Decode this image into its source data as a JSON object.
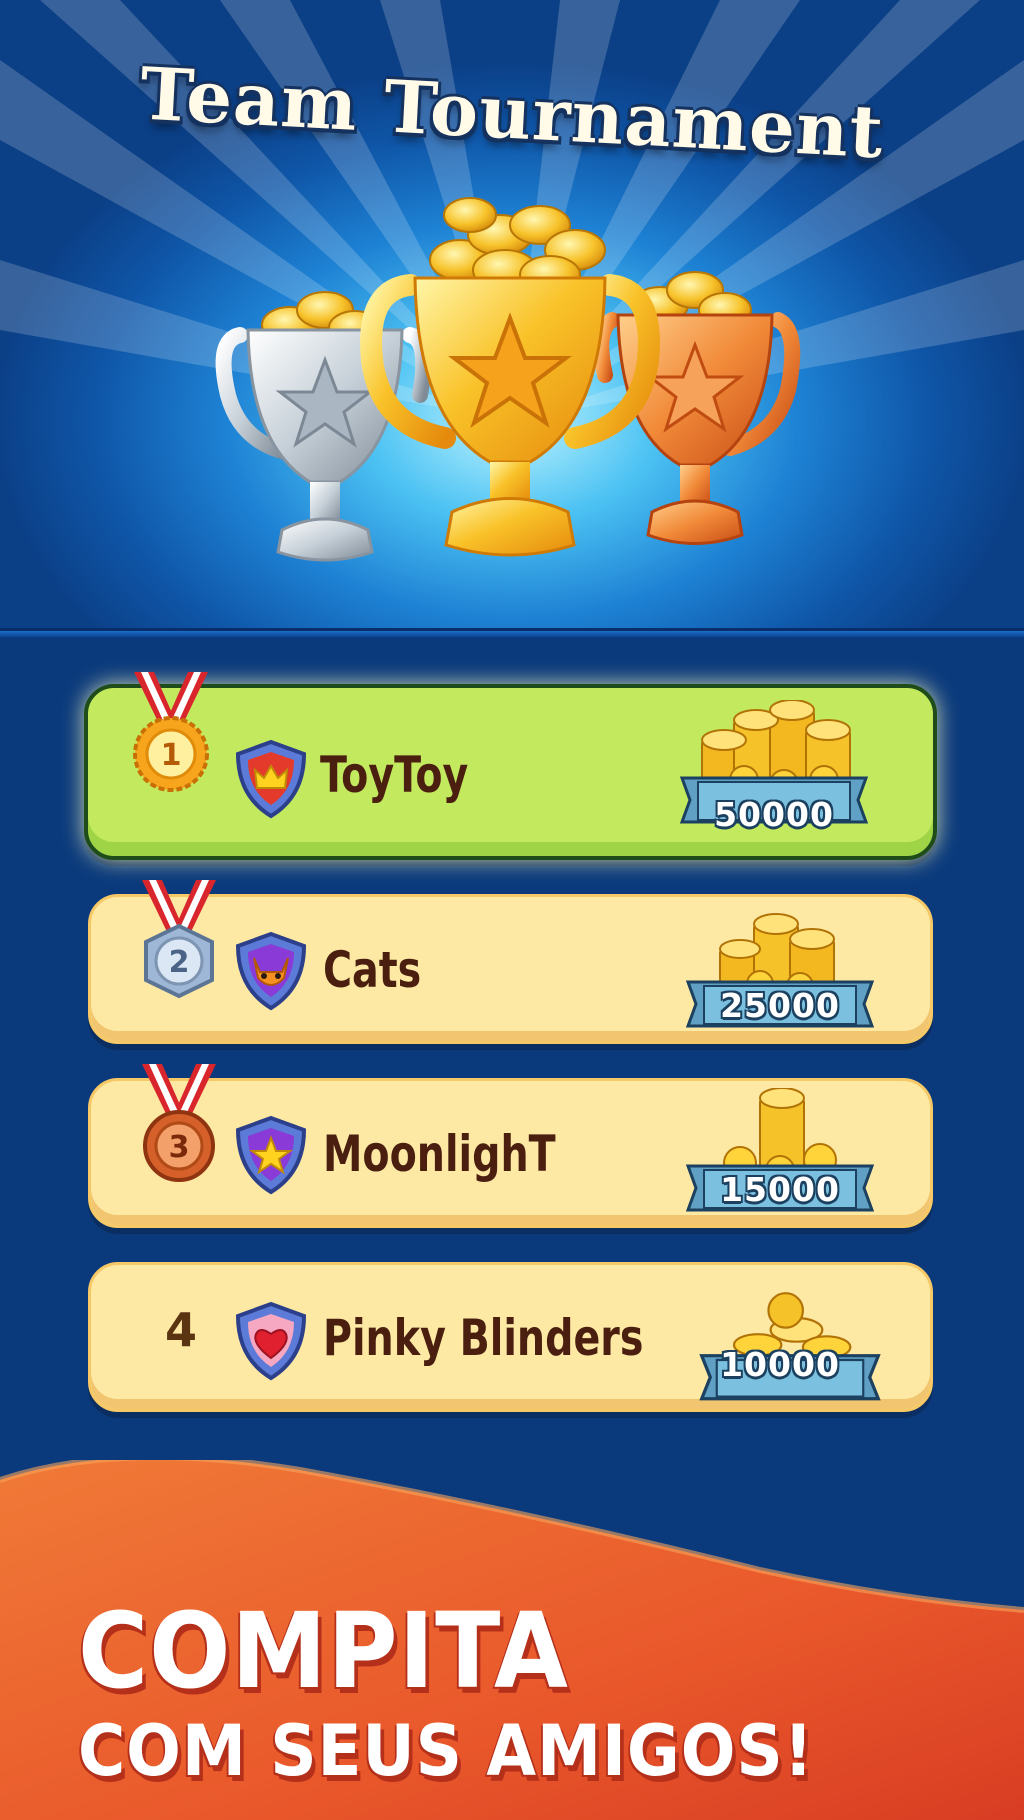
{
  "header": {
    "title": "Team Tournament"
  },
  "leaderboard": {
    "rows": [
      {
        "rank": "1",
        "team": "ToyToy",
        "badge": "crown-shield-icon",
        "reward": "50000",
        "highlighted": true
      },
      {
        "rank": "2",
        "team": "Cats",
        "badge": "cat-shield-icon",
        "reward": "25000",
        "highlighted": false
      },
      {
        "rank": "3",
        "team": "MoonlighT",
        "badge": "star-shield-icon",
        "reward": "15000",
        "highlighted": false
      },
      {
        "rank": "4",
        "team": "Pinky Blinders",
        "badge": "heart-shield-icon",
        "reward": "10000",
        "highlighted": false
      }
    ]
  },
  "banner": {
    "line1": "COMPITA",
    "line2": "COM SEUS AMIGOS!"
  },
  "colors": {
    "highlight_row": "#c3ea5f",
    "row": "#fde9a4",
    "team_text": "#4a1f10",
    "gold": "#f7b21f",
    "silver": "#c9d3dc",
    "bronze": "#e8702a",
    "banner": "#e9582b"
  }
}
